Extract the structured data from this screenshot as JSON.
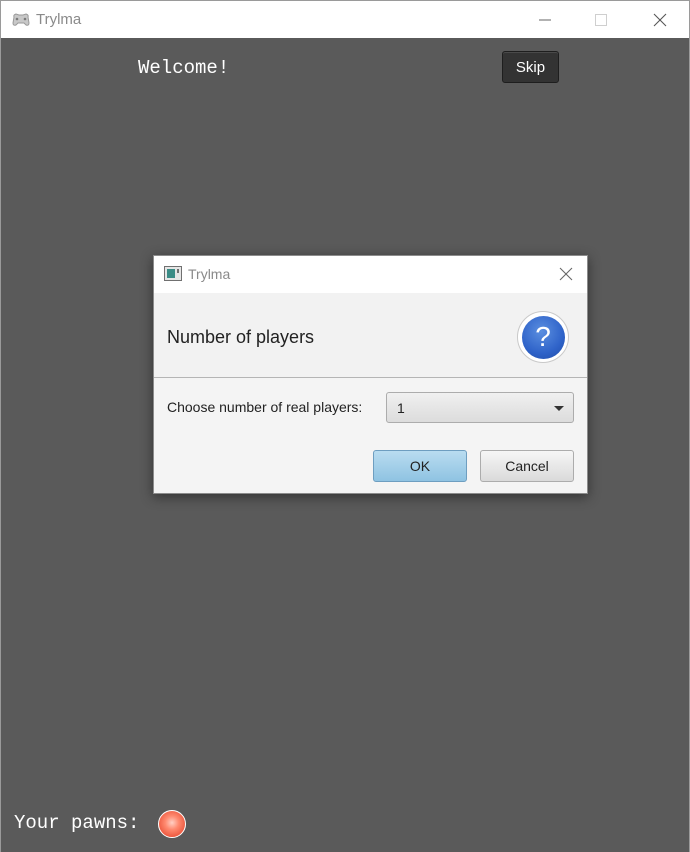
{
  "window": {
    "title": "Trylma",
    "welcome_text": "Welcome!",
    "skip_label": "Skip",
    "pawns_label": "Your pawns:",
    "pawn_color": "#ff6a4d",
    "background": "#5a5a5a"
  },
  "dialog": {
    "title": "Trylma",
    "heading": "Number of players",
    "prompt_label": "Choose number of real players:",
    "select_value": "1",
    "ok_label": "OK",
    "cancel_label": "Cancel",
    "help_icon_glyph": "?",
    "accent": "#2f63c9"
  },
  "icons": {
    "app": "game-controller-icon",
    "dialog_app": "window-icon",
    "help": "question-icon",
    "minimize": "minimize-icon",
    "maximize": "maximize-icon",
    "close": "close-icon",
    "dropdown": "chevron-down-icon"
  }
}
